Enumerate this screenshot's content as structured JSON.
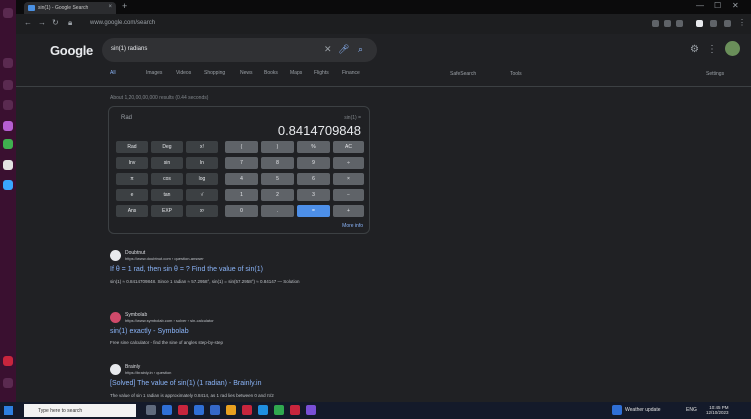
{
  "browser": {
    "tab_title": "sin(1) - Google Search",
    "url": "www.google.com/search",
    "new_tab_symbol": "+",
    "tab_close_symbol": "×",
    "window_controls": [
      "—",
      "☐",
      "✕"
    ]
  },
  "google": {
    "logo": "Google",
    "search_query": "sin(1) radians",
    "clear_symbol": "✕",
    "nav_tabs": [
      "All",
      "Images",
      "Videos",
      "Shopping",
      "News",
      "Books",
      "Maps",
      "Flights",
      "Finance"
    ],
    "tools": [
      "SafeSearch",
      "Tools"
    ],
    "settings_label": "Settings"
  },
  "result_stats": "About 1,20,00,00,000 results (0.44 seconds)",
  "calculator": {
    "mode": "Rad",
    "expression": "sin(1) =",
    "result": "0.8414709848",
    "keys": [
      [
        "Rad",
        "Deg",
        "x!",
        "(",
        ")",
        "%",
        "AC"
      ],
      [
        "Inv",
        "sin",
        "ln",
        "7",
        "8",
        "9",
        "÷"
      ],
      [
        "π",
        "cos",
        "log",
        "4",
        "5",
        "6",
        "×"
      ],
      [
        "e",
        "tan",
        "√",
        "1",
        "2",
        "3",
        "−"
      ],
      [
        "Ans",
        "EXP",
        "xʸ",
        "0",
        ".",
        "=",
        "+"
      ]
    ],
    "more_info": "More info"
  },
  "results": [
    {
      "site": "Doubtnut",
      "url": "https://www.doubtnut.com › question-answer",
      "title": "If θ = 1 rad, then sin θ = ? Find the value of sin(1)",
      "snippet": "sin(1) ≈ 0.8414709848. Since 1 radian ≈ 57.2958°, sin(1) = sin(57.2958°) ≈ 0.84147 — Solution"
    },
    {
      "site": "Symbolab",
      "url": "https://www.symbolab.com › solver › sin-calculator",
      "title": "sin(1) exactly - Symbolab",
      "snippet": "Free sine calculator - find the sine of angles step-by-step"
    },
    {
      "site": "Brainly",
      "url": "https://brainly.in › question",
      "title": "[Solved] The value of sin(1) (1 radian) - Brainly.in",
      "snippet": "The value of sin 1 radian is approximately 0.8414, as 1 rad lies between 0 and π/2"
    }
  ],
  "taskbar": {
    "search_placeholder": "Type here to search",
    "tray_text": "Weather update",
    "lang": "ENG",
    "time": "10:45 PM",
    "date": "12/10/2023"
  },
  "colors": {
    "link": "#8ab4f8",
    "equals_key": "#4d8fe8",
    "dock": "#3a1030",
    "background": "#202124"
  }
}
